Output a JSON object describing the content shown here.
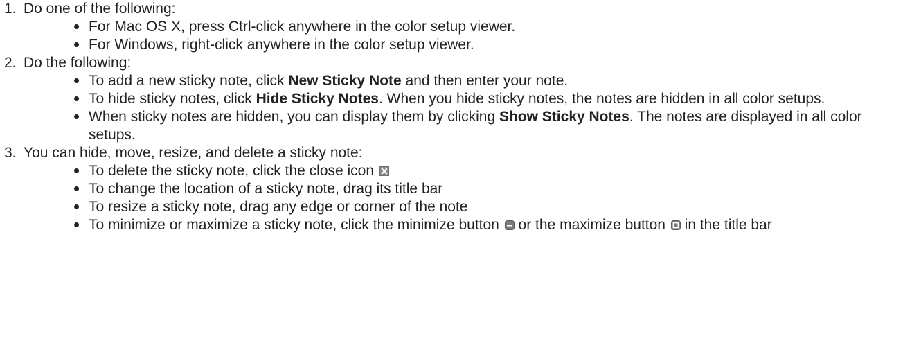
{
  "steps": [
    {
      "number": "1.",
      "text": "Do one of the following:",
      "bullets": [
        {
          "text": "For Mac OS X, press Ctrl-click anywhere in the color setup viewer."
        },
        {
          "text": "For Windows, right-click anywhere in the color setup viewer."
        }
      ]
    },
    {
      "number": "2.",
      "text": "Do the following:",
      "bullets": [
        {
          "pre": "To add a new sticky note, click ",
          "bold": "New Sticky Note",
          "post": " and then enter your note."
        },
        {
          "pre": "To hide sticky notes, click ",
          "bold": "Hide Sticky Notes",
          "post": ". When you hide sticky notes, the notes are hidden in all color setups."
        },
        {
          "pre": "When sticky notes are hidden, you can display them by clicking ",
          "bold": "Show Sticky Notes",
          "post": ". The notes are displayed in all color setups."
        }
      ]
    },
    {
      "number": "3.",
      "text": "You can hide, move, resize, and delete a sticky note:",
      "bullets": [
        {
          "pre": "To delete the sticky note, click the close icon",
          "icon": "close-icon"
        },
        {
          "text": "To change the location of a sticky note, drag its title bar"
        },
        {
          "text": "To resize a sticky note, drag any edge or corner of the note"
        },
        {
          "pre": "To minimize or maximize a sticky note, click the minimize button",
          "icon1": "minimize-icon",
          "mid": " or the maximize button",
          "icon2": "maximize-icon",
          "post": " in the title bar"
        }
      ]
    }
  ],
  "colors": {
    "text": "#222222",
    "icon_gray": "#8a8a8a"
  }
}
